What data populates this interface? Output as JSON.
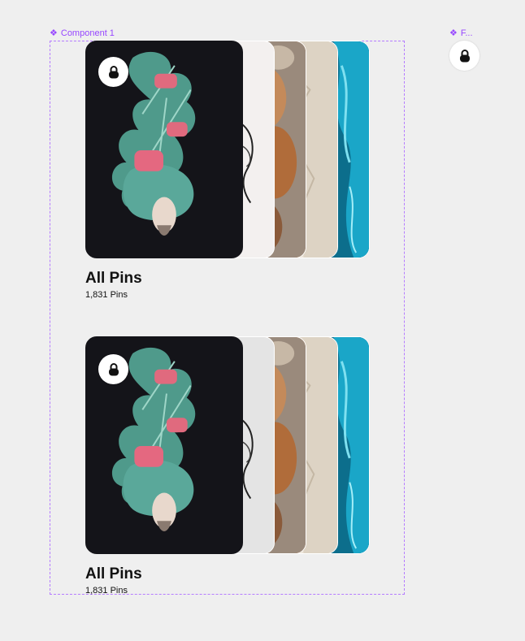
{
  "canvas": {
    "component_label": "Component 1",
    "second_label": "F...",
    "component_icon": "component-diamond-icon",
    "lock_icon": "lock-icon"
  },
  "boards": [
    {
      "title": "All Pins",
      "count": "1,831 Pins"
    },
    {
      "title": "All Pins",
      "count": "1,831 Pins"
    }
  ],
  "colors": {
    "selection": "#9747ff",
    "card_dark": "#141419",
    "card_light": "#f3f0ef",
    "ocean": "#0f7fa0",
    "paper": "#d9cfc0",
    "painting": "#b77a49"
  }
}
